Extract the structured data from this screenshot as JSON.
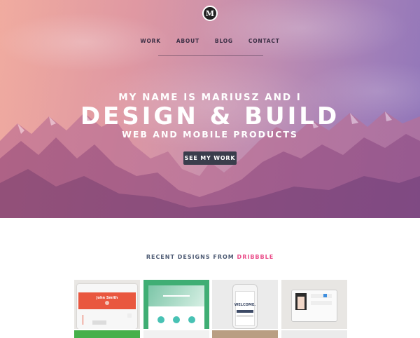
{
  "brand": {
    "logo_letter": "M"
  },
  "nav": {
    "items": [
      "WORK",
      "ABOUT",
      "BLOG",
      "CONTACT"
    ]
  },
  "hero": {
    "intro": "MY NAME IS MARIUSZ AND I",
    "headline": "DESIGN & BUILD",
    "subline": "WEB AND MOBILE PRODUCTS",
    "cta_label": "SEE MY WORK"
  },
  "recent": {
    "prefix": "RECENT DESIGNS FROM",
    "accent_word": "DRIBBBLE"
  },
  "shots": [
    {
      "name": "John Smith",
      "theme": "profile-app"
    },
    {
      "name": "",
      "theme": "green-landing"
    },
    {
      "name": "WELCOME.",
      "theme": "iphone-app"
    },
    {
      "name": "",
      "theme": "tablet-shop"
    }
  ],
  "colors": {
    "accent": "#ea4c89",
    "cta_bg": "#3a3d4c",
    "heading_blue": "#4d5a73"
  }
}
